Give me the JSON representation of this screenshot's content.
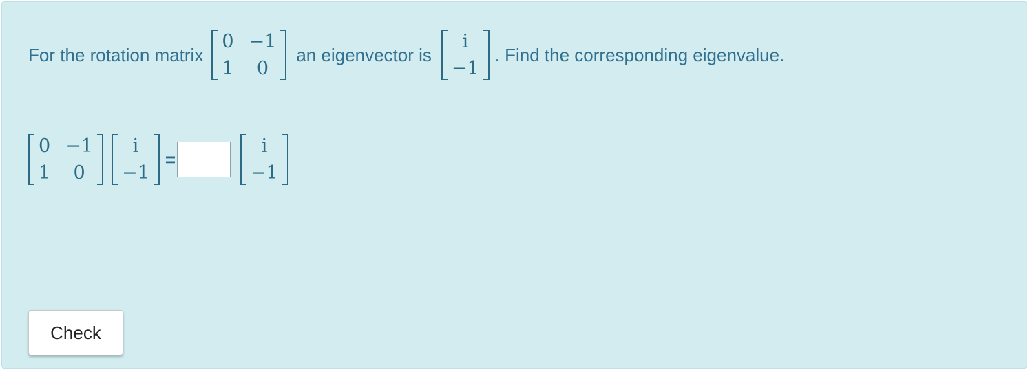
{
  "problem": {
    "text_before": "For the rotation matrix",
    "text_middle": "an eigenvector is",
    "text_after": ". Find the corresponding eigenvalue.",
    "matrix": {
      "r1c1": "0",
      "r1c2": "−1",
      "r2c1": "1",
      "r2c2": "0"
    },
    "vector": {
      "r1": "i",
      "r2": "−1"
    }
  },
  "equation": {
    "equals": "=",
    "answer_value": ""
  },
  "actions": {
    "check_label": "Check"
  }
}
